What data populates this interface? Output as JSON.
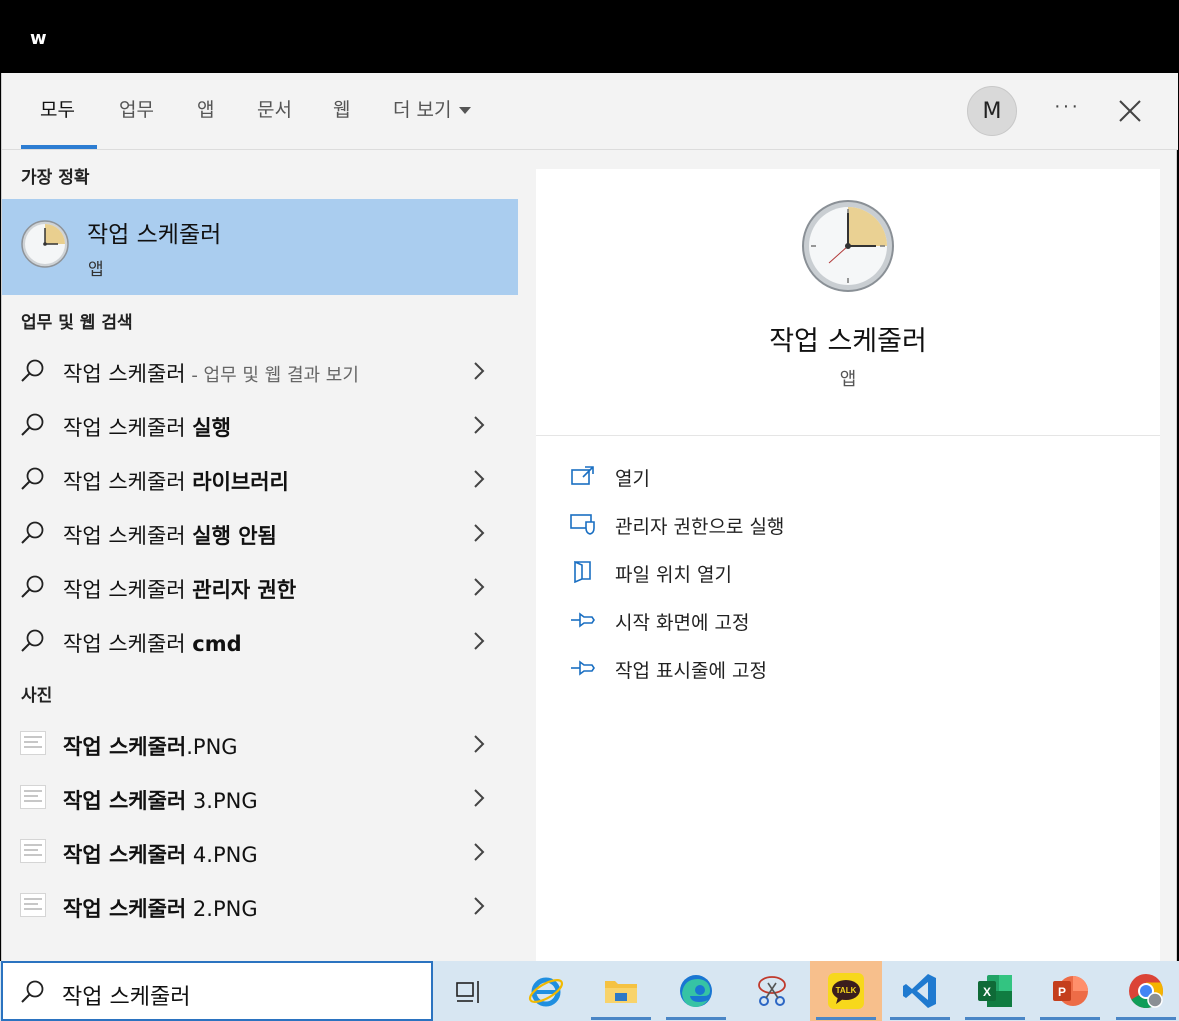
{
  "topbar": {
    "letter": "w"
  },
  "tabs": [
    {
      "label": "모두",
      "active": true
    },
    {
      "label": "업무"
    },
    {
      "label": "앱"
    },
    {
      "label": "문서"
    },
    {
      "label": "웹"
    },
    {
      "label": "더 보기"
    }
  ],
  "header": {
    "avatar_letter": "M",
    "more_label": "···"
  },
  "best_match": {
    "section": "가장 정확",
    "title": "작업 스케줄러",
    "subtitle": "앱"
  },
  "web_search": {
    "section": "업무 및 웹 검색",
    "items": [
      {
        "prefix": "작업 스케줄러",
        "bold": "",
        "suffix": " - 업무 및 웹 결과 보기"
      },
      {
        "prefix": "작업 스케줄러 ",
        "bold": "실행",
        "suffix": ""
      },
      {
        "prefix": "작업 스케줄러 ",
        "bold": "라이브러리",
        "suffix": ""
      },
      {
        "prefix": "작업 스케줄러 ",
        "bold": "실행 안됨",
        "suffix": ""
      },
      {
        "prefix": "작업 스케줄러 ",
        "bold": "관리자 권한",
        "suffix": ""
      },
      {
        "prefix": "작업 스케줄러 ",
        "bold": "cmd",
        "suffix": ""
      }
    ]
  },
  "photos": {
    "section": "사진",
    "items": [
      {
        "bold": "작업 스케줄러",
        "rest": ".PNG"
      },
      {
        "bold": "작업 스케줄러",
        "rest": " 3.PNG"
      },
      {
        "bold": "작업 스케줄러",
        "rest": " 4.PNG"
      },
      {
        "bold": "작업 스케줄러",
        "rest": " 2.PNG"
      }
    ]
  },
  "preview": {
    "title": "작업 스케줄러",
    "subtitle": "앱",
    "actions": [
      {
        "label": "열기",
        "icon": "open-icon"
      },
      {
        "label": "관리자 권한으로 실행",
        "icon": "shield-icon"
      },
      {
        "label": "파일 위치 열기",
        "icon": "file-location-icon"
      },
      {
        "label": "시작 화면에 고정",
        "icon": "pin-icon"
      },
      {
        "label": "작업 표시줄에 고정",
        "icon": "pin-icon"
      }
    ]
  },
  "taskbar": {
    "search_query": "작업 스케줄러",
    "apps": [
      "task-view-icon",
      "internet-explorer-icon",
      "file-explorer-icon",
      "edge-icon",
      "snipping-tool-icon",
      "kakaotalk-icon",
      "vscode-icon",
      "excel-icon",
      "powerpoint-icon",
      "chrome-icon"
    ],
    "kakaotalk_label": "TALK"
  },
  "colors": {
    "accent": "#2d7dd2",
    "selected_bg": "#aacdef",
    "taskbar_bg": "#d7e6f2"
  }
}
